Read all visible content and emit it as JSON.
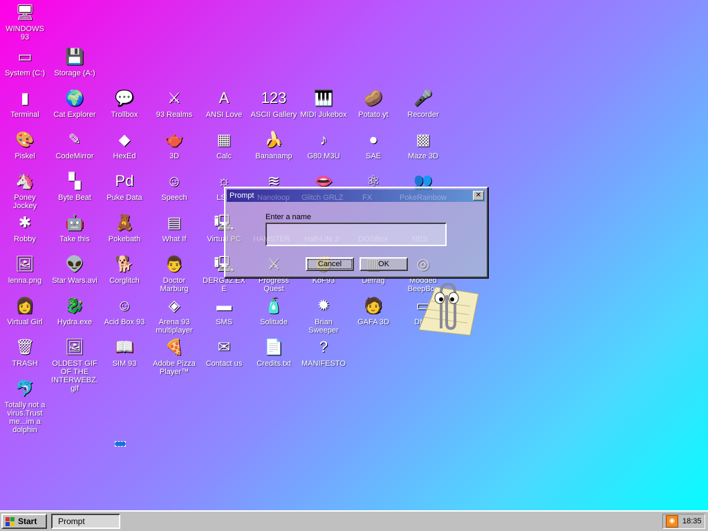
{
  "icons": [
    {
      "name": "windows-93-icon",
      "label": "WINDOWS 93",
      "glyph": "🖥"
    },
    {
      "name": "system-c-icon",
      "label": "System (C:)",
      "glyph": "▭"
    },
    {
      "name": "storage-a-icon",
      "label": "Storage (A:)",
      "glyph": "💾"
    },
    {
      "name": "terminal-icon",
      "label": "Terminal",
      "glyph": "▮"
    },
    {
      "name": "cat-explorer-icon",
      "label": "Cat Explorer",
      "glyph": "🌍"
    },
    {
      "name": "trollbox-icon",
      "label": "Trollbox",
      "glyph": "💬"
    },
    {
      "name": "93-realms-icon",
      "label": "93 Realms",
      "glyph": "⚔"
    },
    {
      "name": "ansi-love-icon",
      "label": "ANSI Love",
      "glyph": "A"
    },
    {
      "name": "ascii-gallery-icon",
      "label": "ASCII Gallery",
      "glyph": "123"
    },
    {
      "name": "midi-jukebox-icon",
      "label": "MIDI Jukebox",
      "glyph": "🎹"
    },
    {
      "name": "potato-yt-icon",
      "label": "Potato.yt",
      "glyph": "🥔"
    },
    {
      "name": "recorder-icon",
      "label": "Recorder",
      "glyph": "🎤"
    },
    {
      "name": "piskel-icon",
      "label": "Piskel",
      "glyph": "🎨"
    },
    {
      "name": "codemirror-icon",
      "label": "CodeMirror",
      "glyph": "✎"
    },
    {
      "name": "hexed-icon",
      "label": "HexEd",
      "glyph": "◆"
    },
    {
      "name": "3d-icon",
      "label": "3D",
      "glyph": "🫖"
    },
    {
      "name": "calc-icon",
      "label": "Calc",
      "glyph": "▦"
    },
    {
      "name": "bananamp-icon",
      "label": "Bananamp",
      "glyph": "🍌"
    },
    {
      "name": "g80-m3u-icon",
      "label": "G80.M3U",
      "glyph": "♪"
    },
    {
      "name": "sae-icon",
      "label": "SAE",
      "glyph": "●"
    },
    {
      "name": "maze-3d-icon",
      "label": "Maze 3D",
      "glyph": "▩"
    },
    {
      "name": "poney-jockey-icon",
      "label": "Poney Jockey",
      "glyph": "🦄"
    },
    {
      "name": "byte-beat-icon",
      "label": "Byte Beat",
      "glyph": "▚"
    },
    {
      "name": "puke-data-icon",
      "label": "Puke Data",
      "glyph": "Pd"
    },
    {
      "name": "speech-icon",
      "label": "Speech",
      "glyph": "☺"
    },
    {
      "name": "lsd-icon",
      "label": "LSD",
      "glyph": "☼"
    },
    {
      "name": "manifesto-partial-icon",
      "label": "",
      "glyph": "≋"
    },
    {
      "name": "lips-icon",
      "label": "",
      "glyph": "👄"
    },
    {
      "name": "fx-icon",
      "label": "",
      "glyph": "⚛"
    },
    {
      "name": "people-icon",
      "label": "",
      "glyph": "👥"
    },
    {
      "name": "robby-icon",
      "label": "Robby",
      "glyph": "✱"
    },
    {
      "name": "take-this-icon",
      "label": "Take this",
      "glyph": "🤖"
    },
    {
      "name": "pokebath-icon",
      "label": "Pokebath",
      "glyph": "🧸"
    },
    {
      "name": "what-if-icon",
      "label": "What If",
      "glyph": "▤"
    },
    {
      "name": "virtual-pc-icon",
      "label": "Virtual PC",
      "glyph": "🖳"
    },
    {
      "name": "lenna-png-icon",
      "label": "lenna.png",
      "glyph": "🖼"
    },
    {
      "name": "star-wars-avi-icon",
      "label": "Star Wars.avi",
      "glyph": "👽"
    },
    {
      "name": "corglitch-icon",
      "label": "Corglitch",
      "glyph": "🐕"
    },
    {
      "name": "doctor-marburg-icon",
      "label": "Doctor Marburg",
      "glyph": "👨"
    },
    {
      "name": "derg32-exe-icon",
      "label": "DERG32.EXE",
      "glyph": "🖳"
    },
    {
      "name": "progress-quest-icon",
      "label": "Progress Quest",
      "glyph": "⚔"
    },
    {
      "name": "kof93-icon",
      "label": "KoF93",
      "glyph": "✊"
    },
    {
      "name": "defrag-icon",
      "label": "Defrag",
      "glyph": "▥"
    },
    {
      "name": "modded-beepbox-icon",
      "label": "Modded BeepBox",
      "glyph": "◎"
    },
    {
      "name": "virtual-girl-icon",
      "label": "Virtual Girl",
      "glyph": "👩"
    },
    {
      "name": "hydra-exe-icon",
      "label": "Hydra.exe",
      "glyph": "🐉"
    },
    {
      "name": "acid-box-93-icon",
      "label": "Acid Box 93",
      "glyph": "☺"
    },
    {
      "name": "arena-93-multiplayer-icon",
      "label": "Arena 93 multiplayer",
      "glyph": "◈"
    },
    {
      "name": "sms-icon",
      "label": "SMS",
      "glyph": "▬"
    },
    {
      "name": "solitude-icon",
      "label": "Solitude",
      "glyph": "🧴"
    },
    {
      "name": "brian-sweeper-icon",
      "label": "Brian Sweeper",
      "glyph": "✹"
    },
    {
      "name": "gafa-3d-icon",
      "label": "GAFA 3D",
      "glyph": "🧑"
    },
    {
      "name": "dmg-icon",
      "label": "DMG",
      "glyph": "▭"
    },
    {
      "name": "trash-icon",
      "label": "TRASH",
      "glyph": "🗑"
    },
    {
      "name": "oldest-gif-icon",
      "label": "OLDEST GIF OF THE INTERWEBZ.gif",
      "glyph": "🖼"
    },
    {
      "name": "sim-93-icon",
      "label": "SIM 93",
      "glyph": "📖"
    },
    {
      "name": "adobe-pizza-player-icon",
      "label": "Adobe Pizza Player™",
      "glyph": "🍕"
    },
    {
      "name": "contact-us-icon",
      "label": "Contact us",
      "glyph": "✉"
    },
    {
      "name": "credits-txt-icon",
      "label": "Credits.txt",
      "glyph": "📄"
    },
    {
      "name": "manifesto-icon",
      "label": "MANIFESTO",
      "glyph": "?"
    },
    {
      "name": "dolphin-icon",
      "label": "Totally not a virus.Trust me...im a dolphin",
      "glyph": "🐬"
    }
  ],
  "ghost_labels": [
    "Nanoloop",
    "Glitch GRLZ",
    "FX",
    "PokeRainbow",
    "HAMSTER",
    "Half-Life 3",
    "DOSBox",
    "NES"
  ],
  "dialog": {
    "title": "Prompt",
    "close_glyph": "✕",
    "prompt_text": "Enter a name",
    "input_value": "",
    "cancel_label": "Cancel",
    "ok_label": "OK"
  },
  "taskbar": {
    "start_label": "Start",
    "task_label": "Prompt",
    "clock": "18:35",
    "tray_icon": "rss-icon"
  }
}
